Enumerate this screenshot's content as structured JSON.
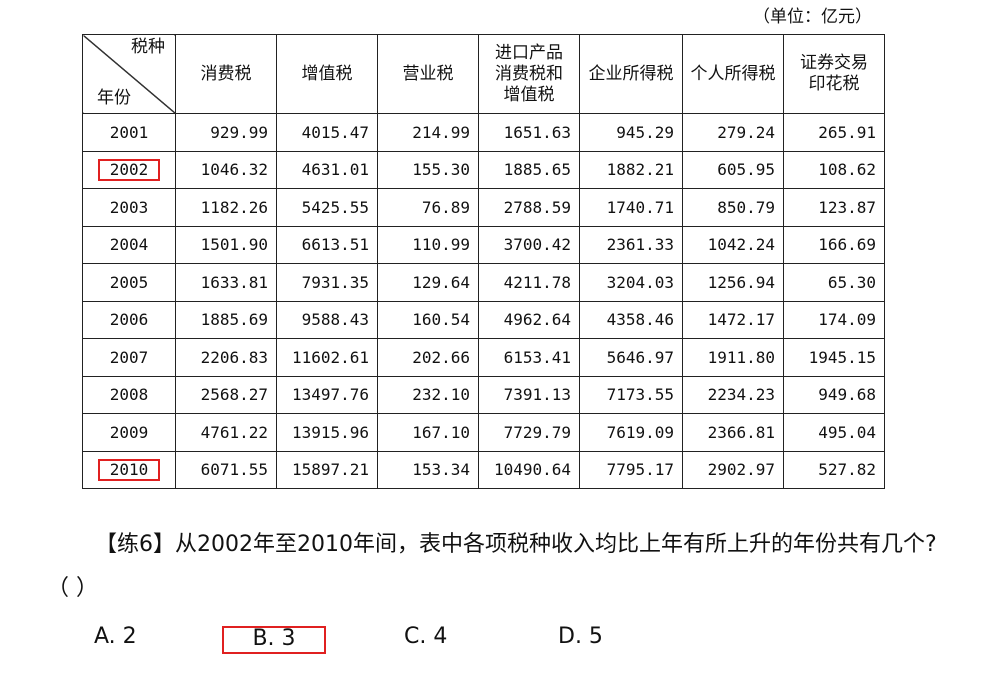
{
  "unit": "（单位：亿元）",
  "table": {
    "corner_top": "税种",
    "corner_bottom": "年份",
    "columns": [
      "消费税",
      "增值税",
      "营业税",
      "进口产品消费税和增值税",
      "企业所得税",
      "个人所得税",
      "证券交易印花税"
    ],
    "rows": [
      {
        "year": "2001",
        "values": [
          "929.99",
          "4015.47",
          "214.99",
          "1651.63",
          "945.29",
          "279.24",
          "265.91"
        ]
      },
      {
        "year": "2002",
        "values": [
          "1046.32",
          "4631.01",
          "155.30",
          "1885.65",
          "1882.21",
          "605.95",
          "108.62"
        ],
        "highlighted": true
      },
      {
        "year": "2003",
        "values": [
          "1182.26",
          "5425.55",
          "76.89",
          "2788.59",
          "1740.71",
          "850.79",
          "123.87"
        ]
      },
      {
        "year": "2004",
        "values": [
          "1501.90",
          "6613.51",
          "110.99",
          "3700.42",
          "2361.33",
          "1042.24",
          "166.69"
        ]
      },
      {
        "year": "2005",
        "values": [
          "1633.81",
          "7931.35",
          "129.64",
          "4211.78",
          "3204.03",
          "1256.94",
          "65.30"
        ]
      },
      {
        "year": "2006",
        "values": [
          "1885.69",
          "9588.43",
          "160.54",
          "4962.64",
          "4358.46",
          "1472.17",
          "174.09"
        ]
      },
      {
        "year": "2007",
        "values": [
          "2206.83",
          "11602.61",
          "202.66",
          "6153.41",
          "5646.97",
          "1911.80",
          "1945.15"
        ]
      },
      {
        "year": "2008",
        "values": [
          "2568.27",
          "13497.76",
          "232.10",
          "7391.13",
          "7173.55",
          "2234.23",
          "949.68"
        ]
      },
      {
        "year": "2009",
        "values": [
          "4761.22",
          "13915.96",
          "167.10",
          "7729.79",
          "7619.09",
          "2366.81",
          "495.04"
        ]
      },
      {
        "year": "2010",
        "values": [
          "6071.55",
          "15897.21",
          "153.34",
          "10490.64",
          "7795.17",
          "2902.97",
          "527.82"
        ],
        "highlighted": true
      }
    ]
  },
  "question": "【练6】从2002年至2010年间，表中各项税种收入均比上年有所上升的年份共有几个?（  ）",
  "options": [
    {
      "label": "A. 2"
    },
    {
      "label": "B. 3",
      "selected": true
    },
    {
      "label": "C. 4"
    },
    {
      "label": "D. 5"
    }
  ],
  "highlight_color": "#e02020"
}
